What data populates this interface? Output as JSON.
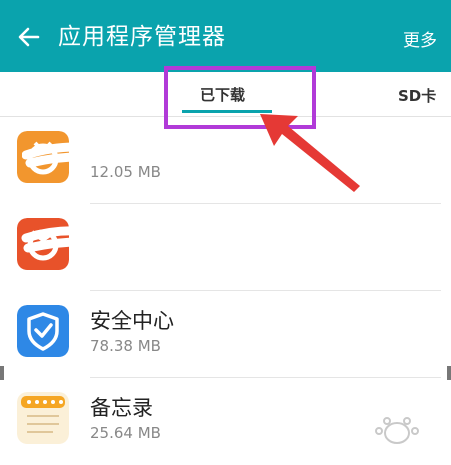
{
  "header": {
    "title": "应用程序管理器",
    "more_label": "更多"
  },
  "tabs": [
    {
      "label": "已下载",
      "selected": true
    },
    {
      "label": "SD卡",
      "selected": false
    }
  ],
  "apps": [
    {
      "name": "",
      "size": "12.05 MB",
      "icon": "orange-app-icon",
      "redacted": true
    },
    {
      "name": "",
      "size": "",
      "icon": "red-app-icon",
      "redacted": true
    },
    {
      "name": "安全中心",
      "size": "78.38 MB",
      "icon": "security-shield-icon",
      "redacted": false
    },
    {
      "name": "备忘录",
      "size": "25.64 MB",
      "icon": "memo-notepad-icon",
      "redacted": false
    }
  ],
  "colors": {
    "header": "#0aa3ad",
    "highlight": "#b13ad8",
    "annotation_arrow": "#e53935",
    "tab_underline": "#0aa3ad"
  }
}
